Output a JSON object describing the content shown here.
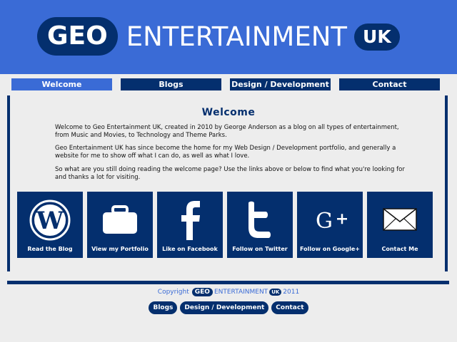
{
  "header": {
    "logo_geo": "GEO",
    "logo_entertainment": "ENTERTAINMENT",
    "logo_uk": "UK"
  },
  "nav": [
    {
      "label": "Welcome",
      "active": true
    },
    {
      "label": "Blogs",
      "active": false
    },
    {
      "label": "Design / Development",
      "active": false
    },
    {
      "label": "Contact",
      "active": false
    }
  ],
  "main": {
    "title": "Welcome",
    "paragraphs": [
      "Welcome to Geo Entertainment UK, created in 2010 by George Anderson as a blog on all types of entertainment, from Music and Movies, to Technology and Theme Parks.",
      "Geo Entertainment UK has since become the home for my Web Design / Development portfolio, and generally a website for me to show off what I can do, as well as what I love.",
      "So what are you still doing reading the welcome page? Use the links above or below to find what you're looking for and thanks a lot for visiting."
    ]
  },
  "tiles": [
    {
      "label": "Read the Blog",
      "icon": "wordpress-icon"
    },
    {
      "label": "View my Portfolio",
      "icon": "briefcase-icon"
    },
    {
      "label": "Like on Facebook",
      "icon": "facebook-icon"
    },
    {
      "label": "Follow on Twitter",
      "icon": "twitter-icon"
    },
    {
      "label": "Follow on Google+",
      "icon": "google-plus-icon"
    },
    {
      "label": "Contact Me",
      "icon": "envelope-icon"
    }
  ],
  "footer": {
    "copyright_prefix": "Copyright",
    "geo": "GEO",
    "entertainment": "ENTERTAINMENT",
    "uk": "UK",
    "year": "2011",
    "links": [
      "Blogs",
      "Design / Development",
      "Contact"
    ]
  },
  "colors": {
    "brand_blue": "#3a6bd6",
    "navy": "#042f6e",
    "background": "#ededed"
  }
}
